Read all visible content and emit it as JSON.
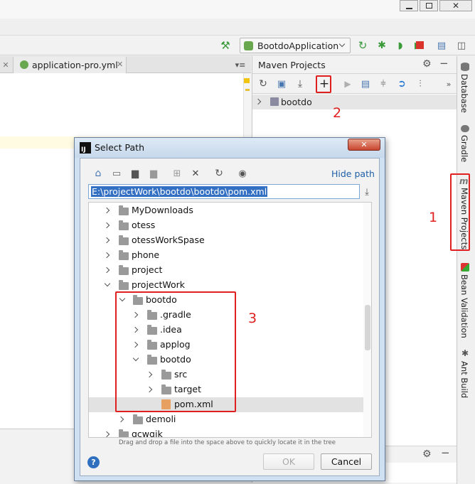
{
  "title_bar": {
    "window_controls": [
      "minimize",
      "restore",
      "close"
    ]
  },
  "toolbar": {
    "run_config": "BootdoApplication",
    "icons": [
      "hammer-icon",
      "rerun-icon",
      "debug-icon",
      "coverage-icon",
      "profile-icon",
      "stop-icon",
      "project-structure-icon",
      "sdk-icon"
    ]
  },
  "editor": {
    "tab_label": "application-pro.yml"
  },
  "maven_panel": {
    "title": "Maven Projects",
    "project_node": "bootdo"
  },
  "right_sidebar": {
    "tabs": [
      "Database",
      "Gradle",
      "Maven Projects",
      "Bean Validation",
      "Ant Build"
    ]
  },
  "dialog": {
    "title": "Select Path",
    "hide_path_link": "Hide path",
    "path_value": "E:\\projectWork\\bootdo\\bootdo\\pom.xml",
    "tree": {
      "my_downloads": "MyDownloads",
      "otess": "otess",
      "otess_workspace": "otessWorkSpase",
      "phone": "phone",
      "project": "project",
      "project_work": "projectWork",
      "bootdo_root": "bootdo",
      "gradle": ".gradle",
      "idea": ".idea",
      "applog": "applog",
      "bootdo_inner": "bootdo",
      "src": "src",
      "target": "target",
      "pom": "pom.xml",
      "demoli": "demoli",
      "gcwqjk": "gcwqjk"
    },
    "hint": "Drag and drop a file into the space above to quickly locate it in the tree",
    "ok_label": "OK",
    "cancel_label": "Cancel",
    "help_label": "?"
  },
  "annotations": {
    "one": "1",
    "two": "2",
    "three": "3"
  },
  "colors": {
    "selection": "#c8dcf0",
    "annotation_red": "#e02020",
    "link_blue": "#1f5fa8",
    "title_bar": "#d6e4f2"
  }
}
